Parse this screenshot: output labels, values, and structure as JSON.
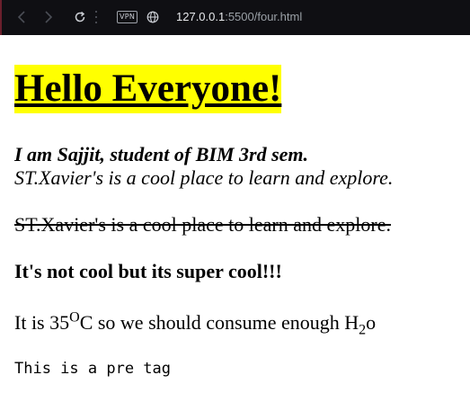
{
  "browser": {
    "back_icon": "arrow-left-icon",
    "forward_icon": "arrow-right-icon",
    "reload_icon": "reload-icon",
    "vpn_label": "VPN",
    "site_icon": "globe-icon",
    "url_host": "127.0.0.1",
    "url_rest": ":5500/four.html"
  },
  "page": {
    "heading": "Hello Everyone!",
    "intro": "I am Sajjit, student of BIM 3rd sem.",
    "tagline": "ST.Xavier's is a cool place to learn and explore.",
    "struck_text": "ST.Xavier's is a cool place to learn and explore.",
    "cool_text": "It's not cool but its super cool!!!",
    "temp": {
      "prefix": "It is 35",
      "superscript": "O",
      "middle": "C so we should consume enough H",
      "subscript": "2",
      "suffix": "o"
    },
    "pre_text": "This is a pre tag"
  },
  "colors": {
    "toolbar_bg": "#0f0f13",
    "heading_highlight": "#ffff00",
    "text": "#000000"
  }
}
